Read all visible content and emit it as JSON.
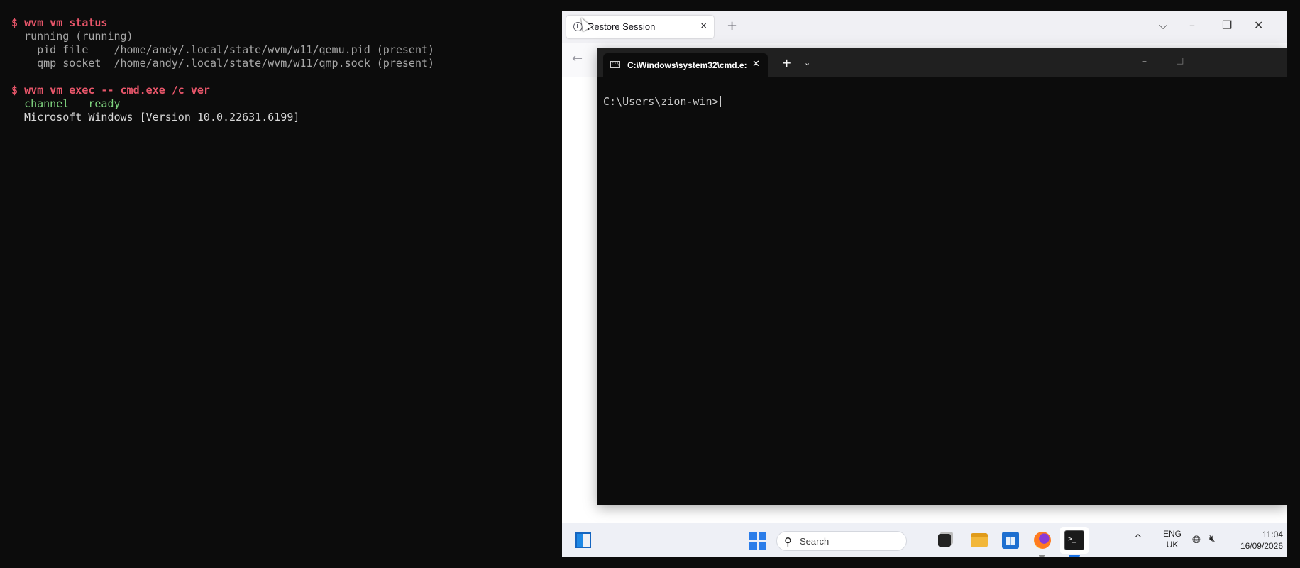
{
  "host_terminal": {
    "lines": [
      {
        "prompt": "$",
        "cmd": "wvm vm status"
      },
      {
        "text": "  running (running)"
      },
      {
        "text": "    pid file    /home/andy/.local/state/wvm/w11/qemu.pid (present)"
      },
      {
        "text": "    qmp socket  /home/andy/.local/state/wvm/w11/qmp.sock (present)"
      },
      {
        "prompt": "$",
        "cmd": "wvm vm exec -- cmd.exe /c ver"
      },
      {
        "key": "channel",
        "value": "ready"
      },
      {
        "text": "  Microsoft Windows [Version 10.0.22631.6199]"
      }
    ]
  },
  "firefox": {
    "tab_title": "Restore Session",
    "tab_close": "×",
    "new_tab": "+",
    "controls": {
      "list_tabs": "⌵",
      "minimize": "–",
      "restore": "❐",
      "close": "✕"
    },
    "back": "←"
  },
  "windows_terminal": {
    "tab_title": "C:\\Windows\\system32\\cmd.e:",
    "tab_close": "✕",
    "new_tab": "+",
    "dropdown": "⌄",
    "minimize": "–",
    "maximize": "□",
    "prompt": "C:\\Users\\zion-win>"
  },
  "taskbar": {
    "search_placeholder": "Search",
    "chevron": "^",
    "language": {
      "line1": "ENG",
      "line2": "UK"
    },
    "time": "11:04",
    "date": "16/09/2026"
  },
  "colors": {
    "prompt": "#e8566a",
    "ready": "#7fd47f",
    "accent": "#1a73e8"
  }
}
